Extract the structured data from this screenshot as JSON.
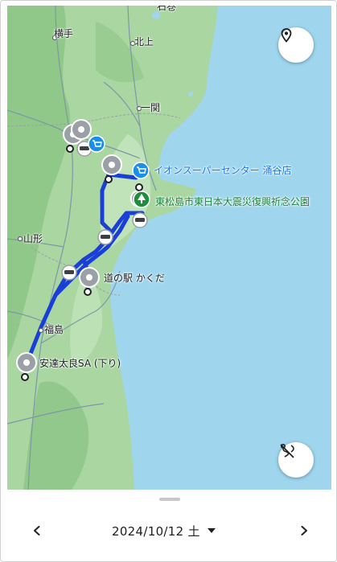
{
  "map": {
    "place_labels": [
      {
        "id": "yokote",
        "text": "横手"
      },
      {
        "id": "kitakami",
        "text": "北上"
      },
      {
        "id": "ichinoseki",
        "text": "一関"
      },
      {
        "id": "yamagata",
        "text": "山形"
      },
      {
        "id": "fukushima",
        "text": "福島"
      },
      {
        "id": "top_cut",
        "text": "石巻"
      }
    ],
    "poi_labels": [
      {
        "id": "aeon",
        "text": "イオンスーパーセンター 涌谷店",
        "kind": "shop"
      },
      {
        "id": "memorial_park",
        "text": "東松島市東日本大震災復興祈念公園",
        "kind": "park"
      },
      {
        "id": "michinoeki",
        "text": "道の駅 かくだ",
        "kind": "place"
      },
      {
        "id": "adatara_sa",
        "text": "安達太良SA (下り)",
        "kind": "place"
      }
    ],
    "route_color": "#1a3fd6",
    "land_color": "#a8d8a0",
    "water_color": "#9fd6ee"
  },
  "controls": {
    "location_button_icon": "location-pin-icon",
    "layers_button_icon": "route-off-icon"
  },
  "bottom_sheet": {
    "date": "2024/10/12 土",
    "prev_icon": "chevron-left-icon",
    "next_icon": "chevron-right-icon",
    "dropdown_icon": "caret-down-icon"
  }
}
